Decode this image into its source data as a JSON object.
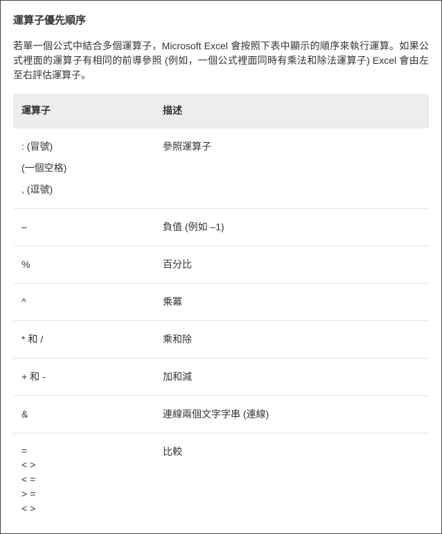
{
  "title": "運算子優先順序",
  "intro": "若單一個公式中結合多個運算子，Microsoft Excel 會按照下表中顯示的順序來執行運算。如果公式裡面的運算子有相同的前導參照 (例如，一個公式裡面同時有乘法和除法運算子) Excel 會由左至右評估運算子。",
  "table": {
    "headers": {
      "operator": "運算子",
      "description": "描述"
    },
    "rows": [
      {
        "operator_lines": [
          ": (冒號)",
          "(一個空格)",
          ", (逗號)"
        ],
        "description": "參照運算子",
        "multi_spaced": true
      },
      {
        "operator_lines": [
          "–"
        ],
        "description": "負值 (例如 –1)"
      },
      {
        "operator_lines": [
          "%"
        ],
        "description": "百分比"
      },
      {
        "operator_lines": [
          "^"
        ],
        "description": "乘冪"
      },
      {
        "operator_lines": [
          "* 和 /"
        ],
        "description": "乘和除"
      },
      {
        "operator_lines": [
          "+ 和 -"
        ],
        "description": "加和減"
      },
      {
        "operator_lines": [
          "&"
        ],
        "description": "連線兩個文字字串 (連線)"
      },
      {
        "operator_lines": [
          "=",
          "< >",
          "< =",
          "> =",
          "< >"
        ],
        "description": "比較",
        "tight": true
      }
    ]
  }
}
